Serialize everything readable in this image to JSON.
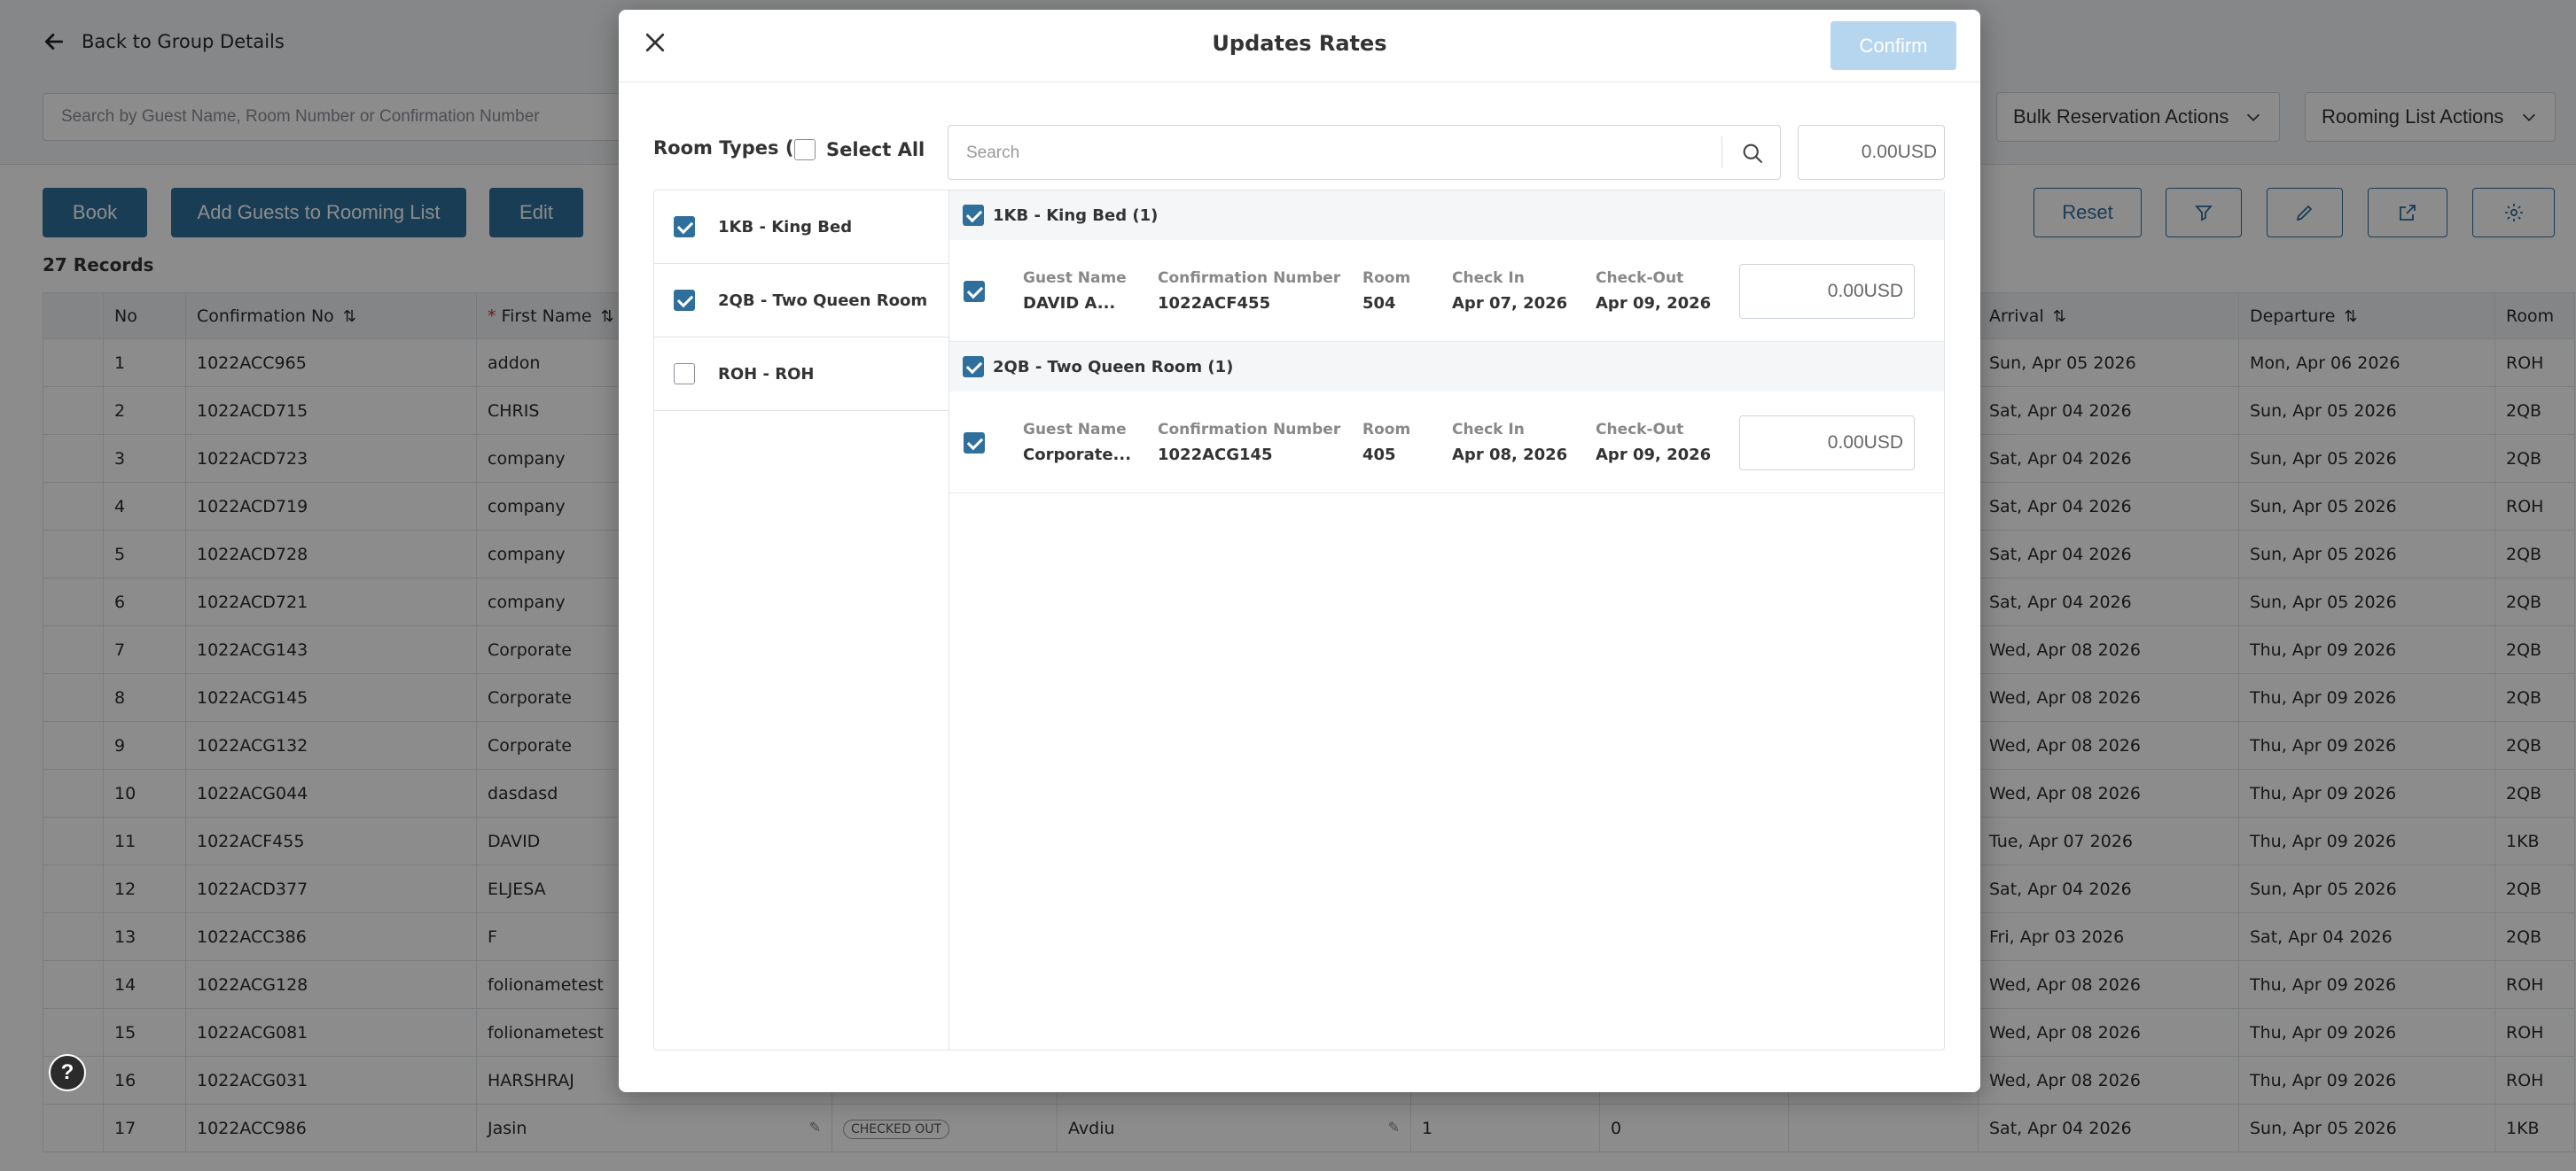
{
  "page": {
    "back_label": "Back to Group Details",
    "search_placeholder": "Search by Guest Name, Room Number or Confirmation Number",
    "bulk_actions_label": "Bulk Reservation Actions",
    "rooming_actions_label": "Rooming List Actions",
    "book_label": "Book",
    "add_guests_label": "Add Guests to Rooming List",
    "edit_label": "Edit",
    "reset_label": "Reset",
    "records_label": "27 Records",
    "help_label": "?"
  },
  "table": {
    "headers": {
      "no": "No",
      "confirmation": "Confirmation No",
      "first_name_req": "*",
      "first_name": "First Name",
      "arrival": "Arrival",
      "departure": "Departure",
      "room": "Room"
    },
    "rows": [
      {
        "no": "1",
        "conf": "1022ACC965",
        "first": "addon",
        "arrival": "Sun, Apr 05 2026",
        "departure": "Mon, Apr 06 2026",
        "room": "ROH"
      },
      {
        "no": "2",
        "conf": "1022ACD715",
        "first": "CHRIS",
        "arrival": "Sat, Apr 04 2026",
        "departure": "Sun, Apr 05 2026",
        "room": "2QB"
      },
      {
        "no": "3",
        "conf": "1022ACD723",
        "first": "company",
        "arrival": "Sat, Apr 04 2026",
        "departure": "Sun, Apr 05 2026",
        "room": "2QB"
      },
      {
        "no": "4",
        "conf": "1022ACD719",
        "first": "company",
        "arrival": "Sat, Apr 04 2026",
        "departure": "Sun, Apr 05 2026",
        "room": "ROH"
      },
      {
        "no": "5",
        "conf": "1022ACD728",
        "first": "company",
        "arrival": "Sat, Apr 04 2026",
        "departure": "Sun, Apr 05 2026",
        "room": "2QB"
      },
      {
        "no": "6",
        "conf": "1022ACD721",
        "first": "company",
        "arrival": "Sat, Apr 04 2026",
        "departure": "Sun, Apr 05 2026",
        "room": "2QB"
      },
      {
        "no": "7",
        "conf": "1022ACG143",
        "first": "Corporate",
        "arrival": "Wed, Apr 08 2026",
        "departure": "Thu, Apr 09 2026",
        "room": "2QB"
      },
      {
        "no": "8",
        "conf": "1022ACG145",
        "first": "Corporate",
        "arrival": "Wed, Apr 08 2026",
        "departure": "Thu, Apr 09 2026",
        "room": "2QB"
      },
      {
        "no": "9",
        "conf": "1022ACG132",
        "first": "Corporate",
        "arrival": "Wed, Apr 08 2026",
        "departure": "Thu, Apr 09 2026",
        "room": "2QB"
      },
      {
        "no": "10",
        "conf": "1022ACG044",
        "first": "dasdasd",
        "arrival": "Wed, Apr 08 2026",
        "departure": "Thu, Apr 09 2026",
        "room": "2QB"
      },
      {
        "no": "11",
        "conf": "1022ACF455",
        "first": "DAVID",
        "arrival": "Tue, Apr 07 2026",
        "departure": "Thu, Apr 09 2026",
        "room": "1KB"
      },
      {
        "no": "12",
        "conf": "1022ACD377",
        "first": "ELJESA",
        "arrival": "Sat, Apr 04 2026",
        "departure": "Sun, Apr 05 2026",
        "room": "2QB"
      },
      {
        "no": "13",
        "conf": "1022ACC386",
        "first": "F",
        "arrival": "Fri, Apr 03 2026",
        "departure": "Sat, Apr 04 2026",
        "room": "2QB"
      },
      {
        "no": "14",
        "conf": "1022ACG128",
        "first": "folionametest",
        "arrival": "Wed, Apr 08 2026",
        "departure": "Thu, Apr 09 2026",
        "room": "ROH"
      },
      {
        "no": "15",
        "conf": "1022ACG081",
        "first": "folionametest",
        "arrival": "Wed, Apr 08 2026",
        "departure": "Thu, Apr 09 2026",
        "room": "ROH"
      },
      {
        "no": "16",
        "conf": "1022ACG031",
        "first": "HARSHRAJ",
        "arrival": "Wed, Apr 08 2026",
        "departure": "Thu, Apr 09 2026",
        "room": "ROH"
      },
      {
        "no": "17",
        "conf": "1022ACC986",
        "first": "Jasin",
        "arrival": "Sat, Apr 04 2026",
        "departure": "Sun, Apr 05 2026",
        "room": "1KB"
      }
    ],
    "row17_extra": {
      "status": "CHECKED OUT",
      "last": "Avdiu",
      "adults": "1",
      "children": "0"
    }
  },
  "modal": {
    "title": "Updates Rates",
    "confirm_label": "Confirm",
    "room_types_label": "Room Types (3)",
    "select_all_label": "Select All",
    "search_placeholder": "Search",
    "amount_value": "0.00USD",
    "room_types": [
      {
        "label": "1KB - King Bed",
        "checked": true
      },
      {
        "label": "2QB - Two Queen Room",
        "checked": true
      },
      {
        "label": "ROH - ROH",
        "checked": false
      }
    ],
    "groups": [
      {
        "heading": "1KB - King Bed (1)",
        "row": {
          "guest_label": "Guest Name",
          "guest": "DAVID A...",
          "conf_label": "Confirmation Number",
          "conf": "1022ACF455",
          "room_label": "Room",
          "room": "504",
          "checkin_label": "Check In",
          "checkin": "Apr 07, 2026",
          "checkout_label": "Check-Out",
          "checkout": "Apr 09, 2026",
          "amount": "0.00USD"
        }
      },
      {
        "heading": "2QB - Two Queen Room (1)",
        "row": {
          "guest_label": "Guest Name",
          "guest": "Corporate...",
          "conf_label": "Confirmation Number",
          "conf": "1022ACG145",
          "room_label": "Room",
          "room": "405",
          "checkin_label": "Check In",
          "checkin": "Apr 08, 2026",
          "checkout_label": "Check-Out",
          "checkout": "Apr 09, 2026",
          "amount": "0.00USD"
        }
      }
    ]
  }
}
